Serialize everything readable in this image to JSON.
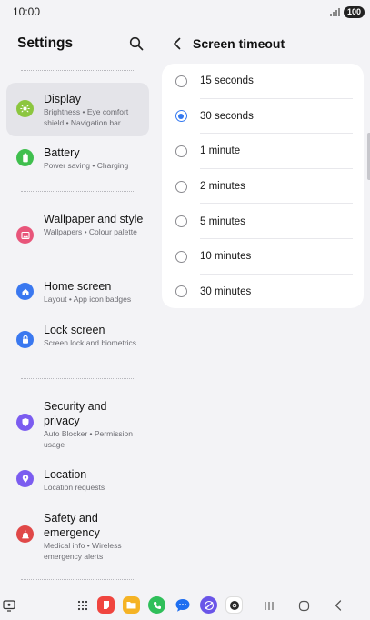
{
  "status_bar": {
    "time": "10:00",
    "battery": "100"
  },
  "left": {
    "title": "Settings",
    "items": [
      {
        "title": "Display",
        "sub": "Brightness • Eye comfort shield • Navigation bar",
        "icon": "sun-icon",
        "color": "#8cc63f"
      },
      {
        "title": "Battery",
        "sub": "Power saving • Charging",
        "icon": "battery-icon",
        "color": "#3fbf4e"
      },
      {
        "title": "Wallpaper and style",
        "sub": "Wallpapers • Colour palette",
        "icon": "image-icon",
        "color": "#e8557a"
      },
      {
        "title": "Home screen",
        "sub": "Layout • App icon badges",
        "icon": "home-icon",
        "color": "#3a78f0"
      },
      {
        "title": "Lock screen",
        "sub": "Screen lock and biometrics",
        "icon": "lock-icon",
        "color": "#3a78f0"
      },
      {
        "title": "Security and privacy",
        "sub": "Auto Blocker • Permission usage",
        "icon": "shield-icon",
        "color": "#7b5cf0"
      },
      {
        "title": "Location",
        "sub": "Location requests",
        "icon": "location-pin-icon",
        "color": "#7b5cf0"
      },
      {
        "title": "Safety and emergency",
        "sub": "Medical info • Wireless emergency alerts",
        "icon": "emergency-icon",
        "color": "#e04848"
      }
    ]
  },
  "right": {
    "title": "Screen timeout",
    "options": [
      "15 seconds",
      "30 seconds",
      "1 minute",
      "2 minutes",
      "5 minutes",
      "10 minutes",
      "30 minutes"
    ],
    "selected": "30 seconds",
    "accent": "#3479f0"
  },
  "dock": {
    "apps": [
      {
        "name": "app-drawer-icon"
      },
      {
        "name": "samsung-notes-icon",
        "color": "#f0453f"
      },
      {
        "name": "my-files-icon",
        "color": "#f5b325"
      },
      {
        "name": "phone-icon",
        "color": "#2fbf5a"
      },
      {
        "name": "messages-icon",
        "color": "#1e6ef0"
      },
      {
        "name": "internet-icon",
        "color": "#6a55e8"
      },
      {
        "name": "camera-icon",
        "color": "#2a2a2a"
      }
    ]
  }
}
